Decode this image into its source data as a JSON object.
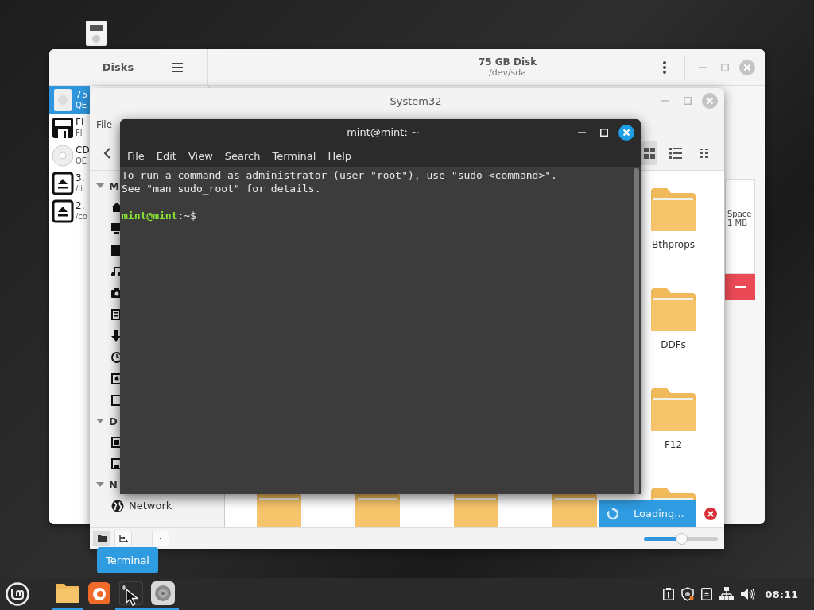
{
  "disks_window": {
    "title": "Disks",
    "heading": "75 GB Disk",
    "subheading": "/dev/sda",
    "drives": [
      {
        "kind": "hdd",
        "name": "75",
        "detail": "QE",
        "selected": true
      },
      {
        "kind": "floppy",
        "name": "Fl",
        "detail": "Fl",
        "selected": false
      },
      {
        "kind": "optical",
        "name": "CD",
        "detail": "QE",
        "selected": false
      },
      {
        "kind": "loop",
        "name": "3.",
        "detail": "/li",
        "selected": false
      },
      {
        "kind": "loop",
        "name": "2.",
        "detail": "/co",
        "selected": false
      }
    ],
    "partition": {
      "label": "Space",
      "size": "1 MB"
    }
  },
  "file_manager": {
    "title": "System32",
    "menu": [
      "File"
    ],
    "views": [
      {
        "kind": "icons",
        "selected": true
      },
      {
        "kind": "list",
        "selected": false
      },
      {
        "kind": "compact",
        "selected": false
      }
    ],
    "sidebar": [
      {
        "heading": "M",
        "expanded": true,
        "children": [
          {
            "kind": "home"
          },
          {
            "kind": "desktop"
          },
          {
            "kind": "documents"
          },
          {
            "kind": "music"
          },
          {
            "kind": "pictures"
          },
          {
            "kind": "videos"
          },
          {
            "kind": "downloads"
          },
          {
            "kind": "recent"
          },
          {
            "kind": "drive"
          },
          {
            "kind": "trash"
          }
        ]
      },
      {
        "heading": "D",
        "expanded": true,
        "children": [
          {
            "kind": "chip"
          },
          {
            "kind": "floppy"
          }
        ]
      },
      {
        "heading": "N",
        "expanded": true,
        "children": [
          {
            "kind": "network",
            "label": "Network"
          }
        ]
      }
    ],
    "folders": [
      {
        "name": "Bthprops"
      },
      {
        "name": "DDFs"
      },
      {
        "name": "F12"
      }
    ],
    "lower_folders": [
      {
        "kind": "folder"
      },
      {
        "kind": "folder"
      },
      {
        "kind": "folder"
      },
      {
        "kind": "folder"
      },
      {
        "kind": "folder"
      }
    ],
    "notification": "Loading...",
    "status_buttons": [
      {
        "kind": "places",
        "selected": true
      },
      {
        "kind": "tree",
        "selected": false
      },
      {
        "kind": "sidebar",
        "selected": false
      }
    ],
    "zoom": {
      "level": 0.5
    }
  },
  "terminal": {
    "title": "mint@mint: ~",
    "menu": [
      "File",
      "Edit",
      "View",
      "Search",
      "Terminal",
      "Help"
    ],
    "lines": [
      "To run a command as administrator (user \"root\"), use \"sudo <command>\".",
      "See \"man sudo_root\" for details."
    ],
    "prompt": {
      "user_host": "mint@mint",
      "path": ":~$"
    }
  },
  "tooltip": "Terminal",
  "taskbar": {
    "apps": [
      {
        "kind": "files",
        "running": true
      },
      {
        "kind": "firefox",
        "running": false
      },
      {
        "kind": "terminal",
        "running": true
      },
      {
        "kind": "disks",
        "running": true
      }
    ],
    "tray": [
      {
        "kind": "update"
      },
      {
        "kind": "shield"
      },
      {
        "kind": "eject"
      },
      {
        "kind": "network"
      },
      {
        "kind": "volume"
      }
    ],
    "clock": "08:11"
  }
}
